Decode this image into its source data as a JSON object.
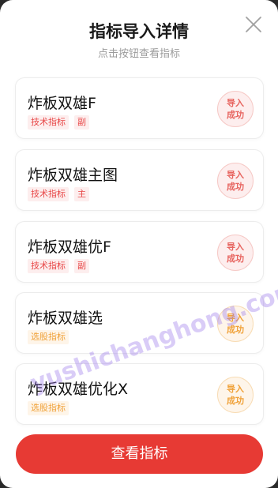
{
  "header": {
    "title": "指标导入详情",
    "subtitle": "点击按钮查看指标"
  },
  "cards": [
    {
      "name": "炸板双雄F",
      "tags": [
        "技术指标",
        "副"
      ],
      "tag_color": "red",
      "badge": [
        "导入",
        "成功"
      ],
      "badge_color": "red"
    },
    {
      "name": "炸板双雄主图",
      "tags": [
        "技术指标",
        "主"
      ],
      "tag_color": "red",
      "badge": [
        "导入",
        "成功"
      ],
      "badge_color": "red"
    },
    {
      "name": "炸板双雄优F",
      "tags": [
        "技术指标",
        "副"
      ],
      "tag_color": "red",
      "badge": [
        "导入",
        "成功"
      ],
      "badge_color": "red"
    },
    {
      "name": "炸板双雄选",
      "tags": [
        "选股指标"
      ],
      "tag_color": "orange",
      "badge": [
        "导入",
        "成功"
      ],
      "badge_color": "orange"
    },
    {
      "name": "炸板双雄优化X",
      "tags": [
        "选股指标"
      ],
      "tag_color": "orange",
      "badge": [
        "导入",
        "成功"
      ],
      "badge_color": "orange"
    }
  ],
  "footer": {
    "button_label": "查看指标"
  },
  "watermark": "yushichanghong.com",
  "colors": {
    "primary_red": "#e73a34",
    "tag_red": "#e84747",
    "tag_orange": "#f0a23a"
  }
}
